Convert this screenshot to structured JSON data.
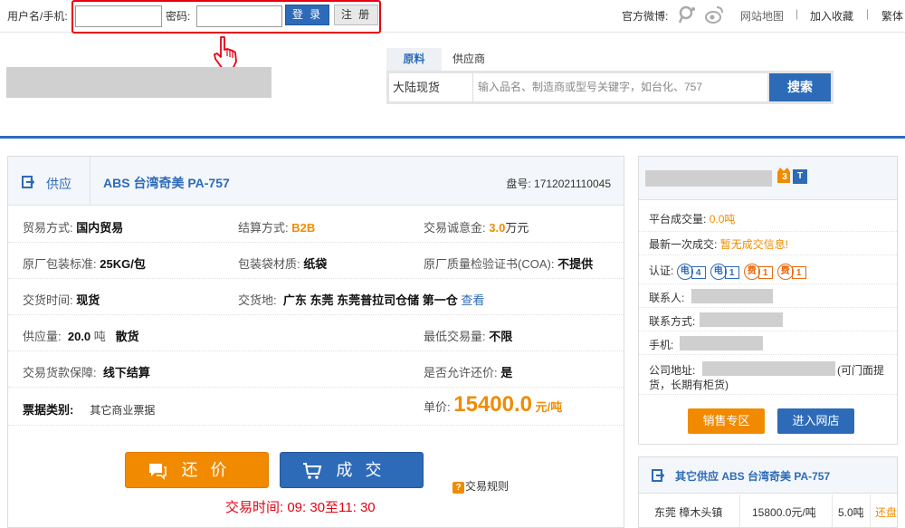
{
  "topbar": {
    "username_label": "用户名/手机:",
    "password_label": "密码:",
    "username_value": "",
    "password_value": "",
    "login_button": "登 录",
    "register_button": "注 册",
    "weibo_label": "官方微博:",
    "sitemap": "网站地图",
    "favorite": "加入收藏",
    "traditional": "繁体",
    "separator": "|"
  },
  "search": {
    "tabs": [
      "原料",
      "供应商"
    ],
    "category": "大陆现货",
    "placeholder": "输入品名、制造商或型号关键字，如台化、757",
    "button": "搜索"
  },
  "product": {
    "supply_label": "供应",
    "title": "ABS 台湾奇美 PA-757",
    "pan_label": "盘号:",
    "pan_no": "1712021110045",
    "trade_mode_k": "贸易方式:",
    "trade_mode_v": "国内贸易",
    "settle_k": "结算方式:",
    "settle_v": "B2B",
    "deposit_k": "交易诚意金:",
    "deposit_v": "3.0",
    "deposit_unit": "万元",
    "pack_k": "原厂包装标准:",
    "pack_v": "25KG/包",
    "bag_k": "包装袋材质:",
    "bag_v": "纸袋",
    "coa_k": "原厂质量检验证书(COA):",
    "coa_v": "不提供",
    "deliver_time_k": "交货时间:",
    "deliver_time_v": "现货",
    "deliver_place_k": "交货地:",
    "deliver_place_v": "广东 东莞 东莞普拉司仓储 第一仓",
    "view_link": "查看",
    "supply_k": "供应量:",
    "supply_v": "20.0",
    "supply_unit": "吨",
    "supply_type": "散货",
    "min_k": "最低交易量:",
    "min_v": "不限",
    "guarantee_k": "交易货款保障:",
    "guarantee_v": "线下结算",
    "bargain_k": "是否允许还价:",
    "bargain_v": "是",
    "invoice_k": "票据类别:",
    "invoice_v": "其它商业票据",
    "price_k": "单价:",
    "price_v": "15400.0",
    "price_unit": "元/吨",
    "bargain_button": "还价",
    "deal_button": "成交",
    "rules_link": "交易规则",
    "rules_icon": "?",
    "trade_time": "交易时间: 09: 30至11: 30"
  },
  "seller": {
    "badge_level": "3",
    "badge_type": "T",
    "volume_k": "平台成交量:",
    "volume_v": "0.0吨",
    "latest_k": "最新一次成交:",
    "latest_v": "暂无成交信息!",
    "cert_k": "认证:",
    "certs": [
      {
        "char": "电",
        "num": "4",
        "color": "#2d6bb8"
      },
      {
        "char": "电",
        "num": "1",
        "color": "#2d6bb8"
      },
      {
        "char": "费",
        "num": "1",
        "color": "#e86a10"
      },
      {
        "char": "费",
        "num": "1",
        "color": "#e86a10"
      }
    ],
    "contact_k": "联系人:",
    "contact_method_k": "联系方式:",
    "phone_k": "手机:",
    "address_k": "公司地址:",
    "address_suffix": "(可门面提",
    "address_line2": "货，长期有柜货)",
    "sale_button": "销售专区",
    "shop_button": "进入网店"
  },
  "other": {
    "title": "其它供应 ABS 台湾奇美 PA-757",
    "location": "东莞 樟木头镇",
    "price": "15800.0元/吨",
    "qty": "5.0吨",
    "action": "还盘"
  },
  "colors": {
    "brand_blue": "#2d6bb8",
    "orange": "#f08c00",
    "red": "#e60012"
  }
}
